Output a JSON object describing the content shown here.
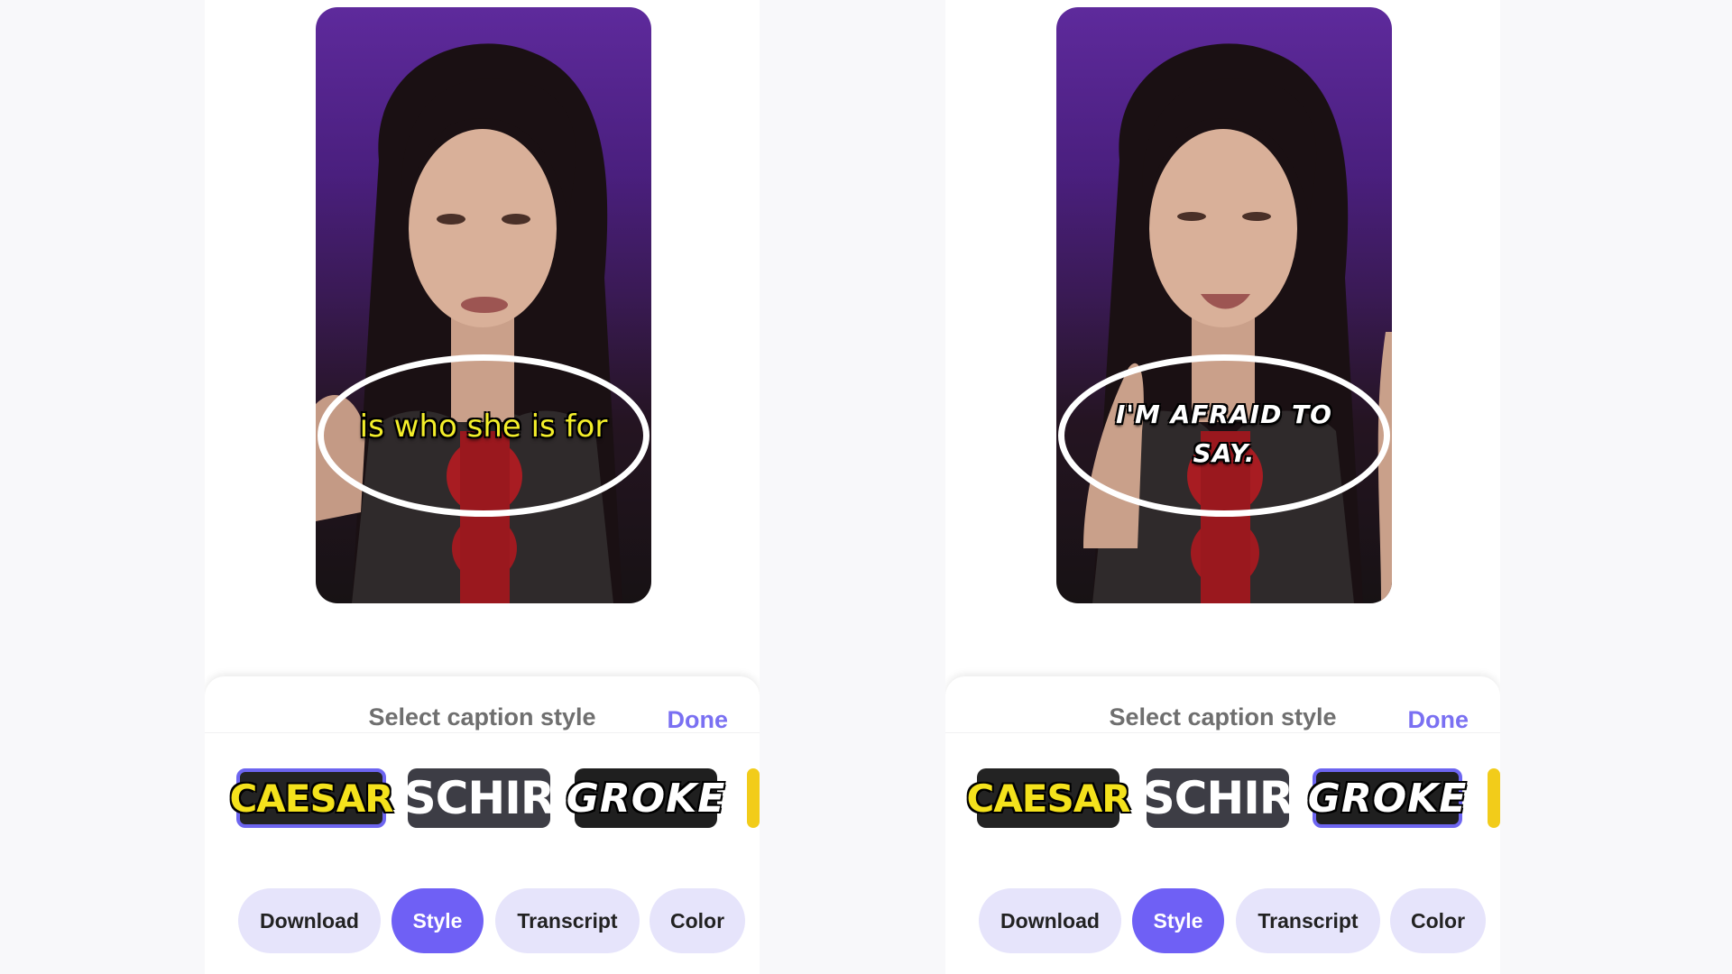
{
  "panels": [
    {
      "video": {
        "caption": "is who she is for"
      },
      "sheet": {
        "title": "Select caption style",
        "done": "Done",
        "styles": [
          "CAESAR",
          "SCHIR",
          "GROKE"
        ],
        "selected_style": "CAESAR",
        "actions": [
          "Download",
          "Style",
          "Transcript",
          "Color"
        ],
        "active_action": "Style"
      }
    },
    {
      "video": {
        "caption_line1": "I'M AFRAID TO",
        "caption_line2": "SAY."
      },
      "sheet": {
        "title": "Select caption style",
        "done": "Done",
        "styles": [
          "CAESAR",
          "SCHIR",
          "GROKE"
        ],
        "selected_style": "GROKE",
        "actions": [
          "Download",
          "Style",
          "Transcript",
          "Color"
        ],
        "active_action": "Style"
      }
    }
  ],
  "colors": {
    "accent": "#6f60f5",
    "pill_bg": "#e6e4fb",
    "caption_yellow": "#f3ee2a",
    "highlight_ring": "#ffffff"
  }
}
